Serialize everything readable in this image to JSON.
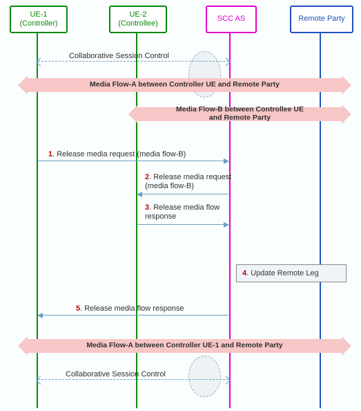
{
  "actors": {
    "ue1": {
      "name": "UE-1",
      "role": "(Controller)"
    },
    "ue2": {
      "name": "UE-2",
      "role": "(Controllee)"
    },
    "scc": {
      "name": "SCC AS"
    },
    "remote": {
      "name": "Remote Party"
    }
  },
  "flows": {
    "control_top": "Collaborative Session Control",
    "media_a_top": "Media Flow-A between Controller UE and Remote Party",
    "media_b": "Media Flow-B between Controllee UE\nand Remote Party",
    "media_a_bottom": "Media Flow-A between Controller UE-1 and Remote Party",
    "control_bottom": "Collaborative Session Control"
  },
  "messages": {
    "m1": {
      "num": "1",
      "text": ". Release media request (media flow-B)"
    },
    "m2": {
      "num": "2",
      "text": ". Release media request\n(media flow-B)"
    },
    "m3": {
      "num": "3",
      "text": ". Release media flow\nresponse"
    },
    "m5": {
      "num": "5",
      "text": ". Release media flow response"
    }
  },
  "notes": {
    "n4": {
      "num": "4",
      "text": ". Update Remote Leg"
    }
  },
  "chart_data": {
    "type": "sequence-diagram",
    "participants": [
      {
        "id": "ue1",
        "label": "UE-1 (Controller)"
      },
      {
        "id": "ue2",
        "label": "UE-2 (Controllee)"
      },
      {
        "id": "scc",
        "label": "SCC AS"
      },
      {
        "id": "remote",
        "label": "Remote Party"
      }
    ],
    "interactions": [
      {
        "kind": "note-flow",
        "from": "ue1",
        "to": "scc",
        "style": "dashed-double",
        "label": "Collaborative Session Control"
      },
      {
        "kind": "media",
        "from": "ue1",
        "to": "remote",
        "label": "Media Flow-A between Controller UE and Remote Party"
      },
      {
        "kind": "media",
        "from": "ue2",
        "to": "remote",
        "label": "Media Flow-B between Controllee UE and Remote Party"
      },
      {
        "kind": "message",
        "step": 1,
        "from": "ue1",
        "to": "scc",
        "label": "Release media request (media flow-B)"
      },
      {
        "kind": "message",
        "step": 2,
        "from": "scc",
        "to": "ue2",
        "label": "Release media request (media flow-B)"
      },
      {
        "kind": "message",
        "step": 3,
        "from": "ue2",
        "to": "scc",
        "label": "Release media flow response"
      },
      {
        "kind": "self-note",
        "step": 4,
        "at": "scc-remote",
        "label": "Update Remote Leg"
      },
      {
        "kind": "message",
        "step": 5,
        "from": "scc",
        "to": "ue1",
        "label": "Release media flow response"
      },
      {
        "kind": "media",
        "from": "ue1",
        "to": "remote",
        "label": "Media Flow-A between Controller UE-1 and Remote Party"
      },
      {
        "kind": "note-flow",
        "from": "ue1",
        "to": "scc",
        "style": "dashed-double",
        "label": "Collaborative Session Control"
      }
    ]
  }
}
